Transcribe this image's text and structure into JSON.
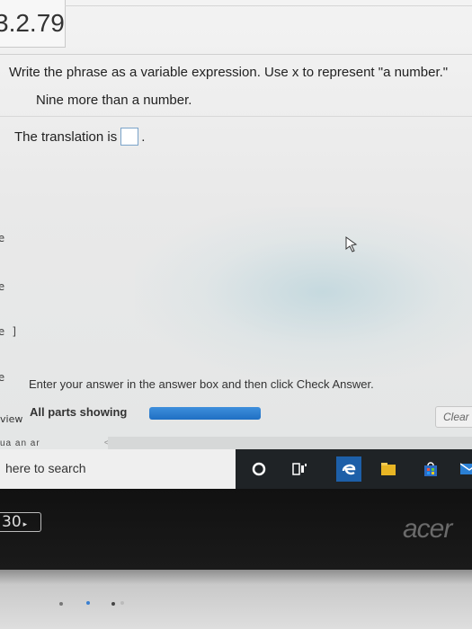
{
  "problem": {
    "number": "3.2.79",
    "question": "Write the phrase as a variable expression. Use x to represent \"a number.\"",
    "phrase": "Nine more than a number.",
    "translation_prefix": "The translation is",
    "translation_suffix": "."
  },
  "answer_box": {
    "value": ""
  },
  "sidebar_fragments": [
    "e",
    "e",
    "e ]",
    "e"
  ],
  "footer": {
    "instruction": "Enter your answer in the answer box and then click Check Answer.",
    "parts_label": "All parts showing",
    "progress_fraction": 1.0,
    "view_label": "view",
    "clear_label": "Clear",
    "truncated_text": "ua an ar",
    "scroll_arrow": "<"
  },
  "taskbar": {
    "search_placeholder": "here to search",
    "icons": [
      "cortana-circle-icon",
      "task-view-icon",
      "edge-icon",
      "file-explorer-icon",
      "store-icon",
      "mail-icon"
    ]
  },
  "bezel": {
    "sticker_text": "30",
    "brand": "acer"
  },
  "colors": {
    "accent": "#1f6fc3",
    "taskbar": "#1f2326",
    "answer_box_border": "#7aa3c9"
  }
}
